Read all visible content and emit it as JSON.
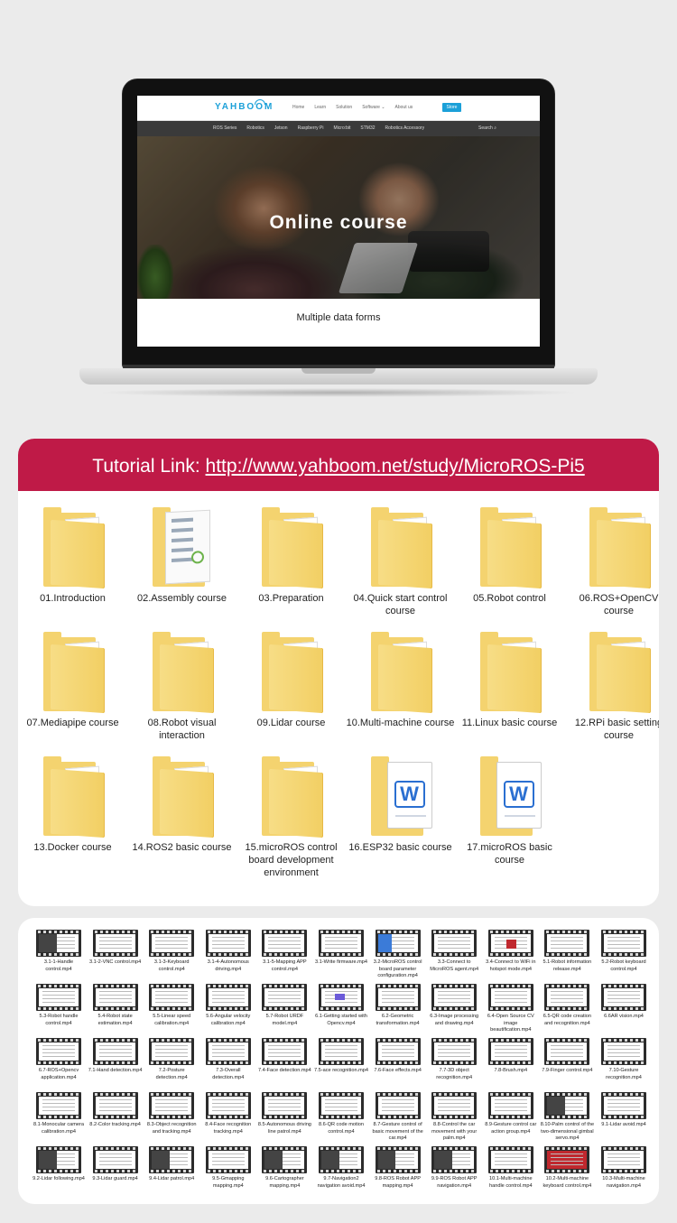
{
  "laptop": {
    "logo": "YAHBOOM",
    "top_nav": [
      "Home",
      "Learn",
      "Solution",
      "Software ⌄",
      "About us"
    ],
    "store_label": "Store",
    "category_nav": [
      "ROS Series",
      "Robotics",
      "Jetson",
      "Raspberry Pi",
      "Micro:bit",
      "STM32",
      "Robotics Accessory"
    ],
    "search_label": "Search",
    "hero_title": "Online course",
    "section_title": "Multiple data forms"
  },
  "tutorial": {
    "prefix": "Tutorial Link: ",
    "url": "http://www.yahboom.net/study/MicroROS-Pi5",
    "folders": [
      {
        "label": "01.Introduction",
        "kind": "folder"
      },
      {
        "label": "02.Assembly course",
        "kind": "assembly"
      },
      {
        "label": "03.Preparation",
        "kind": "folder"
      },
      {
        "label": "04.Quick start control course",
        "kind": "folder"
      },
      {
        "label": "05.Robot control",
        "kind": "folder"
      },
      {
        "label": "06.ROS+OpenCV course",
        "kind": "folder"
      },
      {
        "label": "07.Mediapipe course",
        "kind": "folder"
      },
      {
        "label": "08.Robot visual interaction",
        "kind": "folder"
      },
      {
        "label": "09.Lidar course",
        "kind": "folder"
      },
      {
        "label": "10.Multi-machine course",
        "kind": "folder"
      },
      {
        "label": "11.Linux basic course",
        "kind": "folder"
      },
      {
        "label": "12.RPi basic setting course",
        "kind": "folder"
      },
      {
        "label": "13.Docker course",
        "kind": "folder"
      },
      {
        "label": "14.ROS2 basic course",
        "kind": "folder"
      },
      {
        "label": "15.microROS control board development environment",
        "kind": "folder"
      },
      {
        "label": "16.ESP32 basic course",
        "kind": "word"
      },
      {
        "label": "17.microROS basic course",
        "kind": "word"
      }
    ]
  },
  "videos": [
    {
      "label": "3.1-1-Handle control.mp4",
      "style": "dark"
    },
    {
      "label": "3.1-2-VNC control.mp4",
      "style": "plain"
    },
    {
      "label": "3.1-3-Keyboard control.mp4",
      "style": "plain"
    },
    {
      "label": "3.1-4-Autonomous driving.mp4",
      "style": "plain"
    },
    {
      "label": "3.1-5-Mapping APP control.mp4",
      "style": "plain"
    },
    {
      "label": "3.1-Write firmware.mp4",
      "style": "plain"
    },
    {
      "label": "3.2-MicroROS control board parameter configuration.mp4",
      "style": "blue"
    },
    {
      "label": "3.3-Connect to MicroROS agent.mp4",
      "style": "plain"
    },
    {
      "label": "3.4-Connect to WiFi in hotspot mode.mp4",
      "style": "red"
    },
    {
      "label": "5.1-Robot information release.mp4",
      "style": "plain"
    },
    {
      "label": "5.2-Robot keyboard control.mp4",
      "style": "plain"
    },
    {
      "label": "5.3-Robot handle control.mp4",
      "style": "plain"
    },
    {
      "label": "5.4-Robot state estimation.mp4",
      "style": "plain"
    },
    {
      "label": "5.5-Linear speed calibration.mp4",
      "style": "plain"
    },
    {
      "label": "5.6-Angular velocity calibration.mp4",
      "style": "plain"
    },
    {
      "label": "5.7-Robot URDF model.mp4",
      "style": "plain"
    },
    {
      "label": "6.1-Getting started with Opencv.mp4",
      "style": "purple"
    },
    {
      "label": "6.2-Geometric transformation.mp4",
      "style": "plain"
    },
    {
      "label": "6.3-Image processing and drawing.mp4",
      "style": "plain"
    },
    {
      "label": "6.4-Open Source CV image beautification.mp4",
      "style": "plain"
    },
    {
      "label": "6.5-QR code creation and recognition.mp4",
      "style": "plain"
    },
    {
      "label": "6.6AR vision.mp4",
      "style": "plain"
    },
    {
      "label": "6.7-ROS+Opencv application.mp4",
      "style": "plain"
    },
    {
      "label": "7.1-Hand detection.mp4",
      "style": "plain"
    },
    {
      "label": "7.2-Posture detection.mp4",
      "style": "plain"
    },
    {
      "label": "7.3-Overall detection.mp4",
      "style": "plain"
    },
    {
      "label": "7.4-Face detection.mp4",
      "style": "plain"
    },
    {
      "label": "7.5-ace recognition.mp4",
      "style": "plain"
    },
    {
      "label": "7.6-Face effects.mp4",
      "style": "plain"
    },
    {
      "label": "7.7-3D object recognition.mp4",
      "style": "plain"
    },
    {
      "label": "7.8-Brush.mp4",
      "style": "plain"
    },
    {
      "label": "7.9-Finger control.mp4",
      "style": "plain"
    },
    {
      "label": "7.10-Gesture recognition.mp4",
      "style": "plain"
    },
    {
      "label": "8.1-Monocular camera calibration.mp4",
      "style": "plain"
    },
    {
      "label": "8.2-Color tracking.mp4",
      "style": "plain"
    },
    {
      "label": "8.3-Object recognition and tracking.mp4",
      "style": "plain"
    },
    {
      "label": "8.4-Face recognition tracking.mp4",
      "style": "plain"
    },
    {
      "label": "8.5-Autonomous driving line patrol.mp4",
      "style": "plain"
    },
    {
      "label": "8.6-QR code motion control.mp4",
      "style": "plain"
    },
    {
      "label": "8.7-Gesture control of basic movement of the car.mp4",
      "style": "plain"
    },
    {
      "label": "8.8-Control the car movement with your palm.mp4",
      "style": "plain"
    },
    {
      "label": "8.9-Gesture control car action group.mp4",
      "style": "plain"
    },
    {
      "label": "8.10-Palm control of the two-dimensional gimbal servo.mp4",
      "style": "dark"
    },
    {
      "label": "9.1-Lidar avoid.mp4",
      "style": "plain"
    },
    {
      "label": "9.2-Lidar following.mp4",
      "style": "dark"
    },
    {
      "label": "9.3-Lidar guard.mp4",
      "style": "plain"
    },
    {
      "label": "9.4-Lidar patrol.mp4",
      "style": "dark"
    },
    {
      "label": "9.5-Gmapping mapping.mp4",
      "style": "plain"
    },
    {
      "label": "9.6-Cartographer mapping.mp4",
      "style": "dark"
    },
    {
      "label": "9.7-Navigation2 navigation avoid.mp4",
      "style": "dark"
    },
    {
      "label": "9.8-ROS Robot APP mapping.mp4",
      "style": "dark"
    },
    {
      "label": "9.9-ROS Robot APP navigation.mp4",
      "style": "dark"
    },
    {
      "label": "10.1-Multi-machine handle control.mp4",
      "style": "plain"
    },
    {
      "label": "10.2-Multi-machine keyboard control.mp4",
      "style": "redfull"
    },
    {
      "label": "10.3-Multi-machine navigation.mp4",
      "style": "plain"
    }
  ]
}
